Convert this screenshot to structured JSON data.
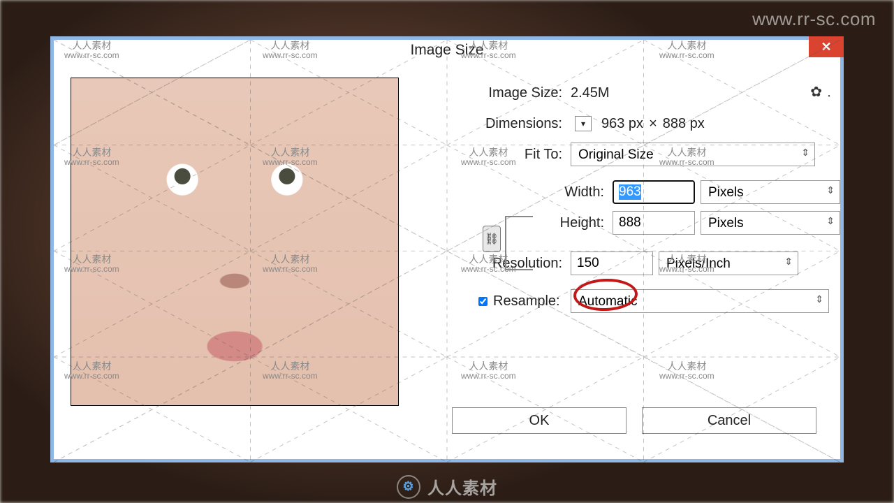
{
  "watermark": {
    "url": "www.rr-sc.com",
    "brand_cn": "人人素材",
    "footer": "人人素材"
  },
  "dialog": {
    "title": "Image Size",
    "labels": {
      "image_size": "Image Size:",
      "dimensions": "Dimensions:",
      "fit_to": "Fit To:",
      "width": "Width:",
      "height": "Height:",
      "resolution": "Resolution:",
      "resample": "Resample:"
    },
    "values": {
      "image_size": "2.45M",
      "dimensions_w": "963 px",
      "dimensions_h": "888 px",
      "width": "963",
      "height": "888",
      "resolution": "150"
    },
    "selects": {
      "fit_to": "Original Size",
      "width_unit": "Pixels",
      "height_unit": "Pixels",
      "resolution_unit": "Pixels/Inch",
      "resample": "Automatic"
    },
    "resample_checked": true,
    "buttons": {
      "ok": "OK",
      "cancel": "Cancel"
    }
  }
}
